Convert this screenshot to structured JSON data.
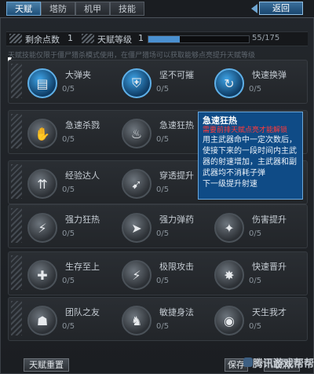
{
  "tabs": [
    "天赋",
    "塔防",
    "机甲",
    "技能"
  ],
  "back_label": "返回",
  "header": {
    "points_label": "剩余点数",
    "points_value": "1",
    "level_label": "天赋等级",
    "level_value": "1",
    "progress_text": "55/175",
    "progress_fraction": 0.314
  },
  "notice": "天赋技能仅限于僵尸猎杀模式使用，在僵尸猎场可以获取能够点亮提升天赋等级",
  "talents": [
    [
      {
        "name": "大弹夹",
        "count": "0/5",
        "icon": "magazine-icon",
        "active": true
      },
      {
        "name": "坚不可摧",
        "count": "0/5",
        "icon": "shield-icon",
        "active": true
      },
      {
        "name": "快速换弹",
        "count": "0/5",
        "icon": "reload-icon",
        "active": true
      }
    ],
    [
      {
        "name": "急速杀戮",
        "count": "0/5",
        "icon": "claw-icon",
        "active": false
      },
      {
        "name": "急速狂热",
        "count": "0/5",
        "icon": "fire-icon",
        "active": false
      },
      {
        "name": "",
        "count": "",
        "icon": "",
        "active": false
      }
    ],
    [
      {
        "name": "经验达人",
        "count": "0/5",
        "icon": "up-arrow-icon",
        "active": false
      },
      {
        "name": "穿透提升",
        "count": "0/5",
        "icon": "pierce-icon",
        "active": false
      },
      {
        "name": "",
        "count": "",
        "icon": "",
        "active": false
      }
    ],
    [
      {
        "name": "强力狂热",
        "count": "0/5",
        "icon": "strike-icon",
        "active": false
      },
      {
        "name": "强力弹药",
        "count": "0/5",
        "icon": "bullet-icon",
        "active": false
      },
      {
        "name": "伤害提升",
        "count": "0/5",
        "icon": "gun-icon",
        "active": false
      }
    ],
    [
      {
        "name": "生存至上",
        "count": "0/5",
        "icon": "cross-icon",
        "active": false
      },
      {
        "name": "极限攻击",
        "count": "0/5",
        "icon": "strike-icon",
        "active": false
      },
      {
        "name": "快速晋升",
        "count": "0/5",
        "icon": "star-icon",
        "active": false
      }
    ],
    [
      {
        "name": "团队之友",
        "count": "0/5",
        "icon": "team-icon",
        "active": false
      },
      {
        "name": "敏捷身法",
        "count": "0/5",
        "icon": "runner-icon",
        "active": false
      },
      {
        "name": "天生我才",
        "count": "0/5",
        "icon": "eye-icon",
        "active": false
      }
    ]
  ],
  "tooltip": {
    "title": "急速狂热",
    "requirement": "需要前排天赋点亮才能解锁",
    "desc": "用主武器命中一定次数后，使接下来的一段时间内主武器的射速增加，主武器和副武器均不消耗子弹",
    "next": "下一级提升射速"
  },
  "footer": {
    "reset_label": "天赋重置",
    "save_label": "保存",
    "cancel_label": "取消",
    "watermark": "腾讯游戏帮帮"
  }
}
